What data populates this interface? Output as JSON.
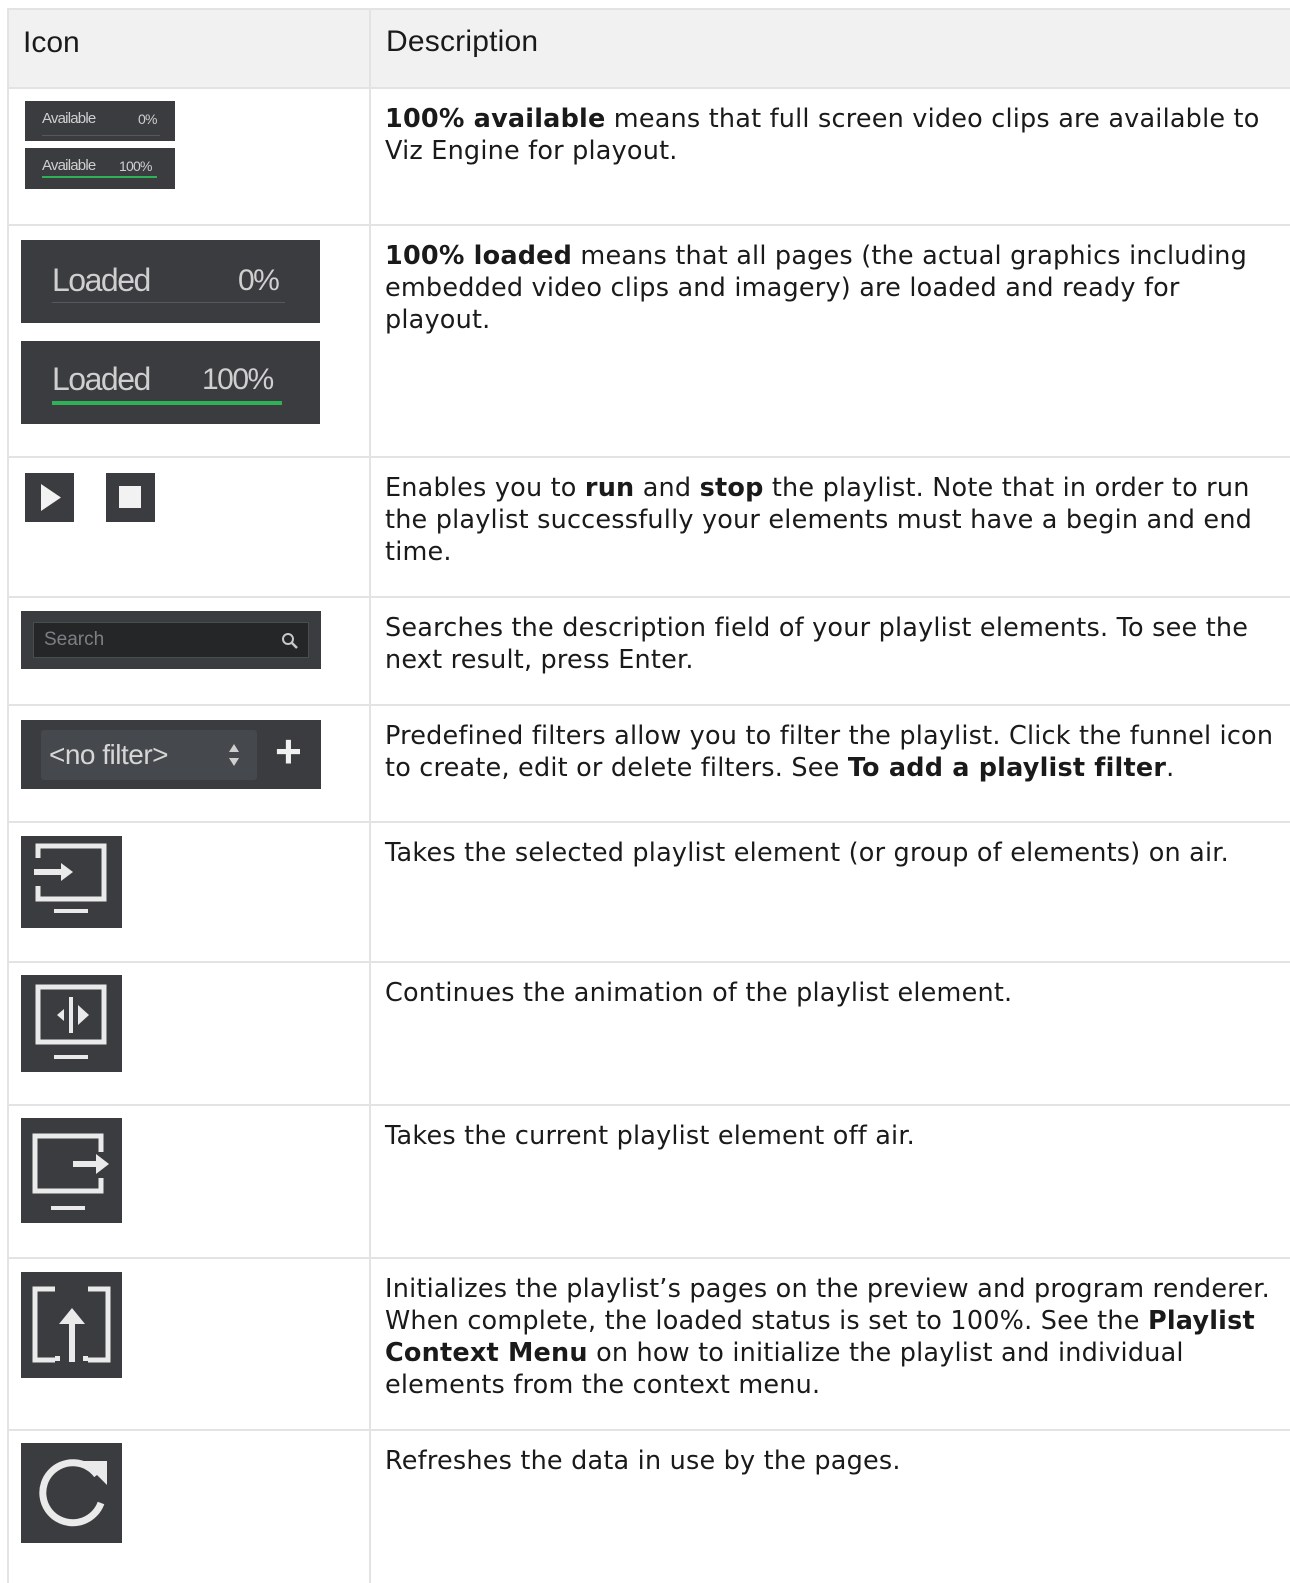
{
  "header": {
    "icon_col": "Icon",
    "desc_col": "Description"
  },
  "rows": [
    {
      "name": "available-status",
      "icon": {
        "a_label": "Available",
        "a_value": "0%",
        "b_label": "Available",
        "b_value": "100%",
        "a_progress": 0,
        "b_progress": 1
      },
      "bold": "100% available",
      "text": " means that full screen video clips are available to Viz Engine for playout."
    },
    {
      "name": "loaded-status",
      "icon": {
        "a_label": "Loaded",
        "a_value": "0%",
        "b_label": "Loaded",
        "b_value": "100%",
        "a_progress": 0,
        "b_progress": 1
      },
      "bold": "100% loaded",
      "text": " means that all pages (the actual graphics including embedded video clips and imagery) are loaded and ready for playout."
    },
    {
      "name": "run-stop",
      "icon": {
        "run": "play-icon",
        "stop": "stop-icon"
      },
      "t1": "Enables you to ",
      "b1": "run",
      "t2": " and ",
      "b2": "stop",
      "t3": " the playlist. Note that in order to run the playlist successfully your elements must have a begin and end time."
    },
    {
      "name": "search",
      "icon": {
        "placeholder": "Search",
        "glyph": "search-icon"
      },
      "text": "Searches the description field of your playlist elements. To see the next result, press Enter."
    },
    {
      "name": "filter",
      "icon": {
        "selected": "<no filter>",
        "add": "+"
      },
      "t1": "Predefined filters allow you to filter the playlist. Click the funnel icon to create, edit or delete filters. See ",
      "b1": "To add a playlist filter",
      "t2": "."
    },
    {
      "name": "take",
      "icon": {
        "glyph": "take-on-air-icon"
      },
      "text": "Takes the selected playlist element (or group of elements) on air."
    },
    {
      "name": "continue",
      "icon": {
        "glyph": "continue-icon"
      },
      "text": "Continues the animation of the playlist element."
    },
    {
      "name": "take-out",
      "icon": {
        "glyph": "take-off-air-icon"
      },
      "text": "Takes the current playlist element off air."
    },
    {
      "name": "initialize",
      "icon": {
        "glyph": "initialize-icon"
      },
      "t1": "Initializes the playlist’s pages on the preview and program renderer. When complete, the loaded status is set to 100%. See the ",
      "b1": "Playlist Context Menu",
      "t2": " on how to initialize the playlist and individual elements from the context menu."
    },
    {
      "name": "refresh",
      "icon": {
        "glyph": "refresh-icon"
      },
      "text": "Refreshes the data in use by the pages."
    }
  ],
  "colors": {
    "icon_bg": "#3a3c3f",
    "progress": "#2fb158",
    "border": "#e3e3e3",
    "header_bg": "#f1f1f1"
  }
}
